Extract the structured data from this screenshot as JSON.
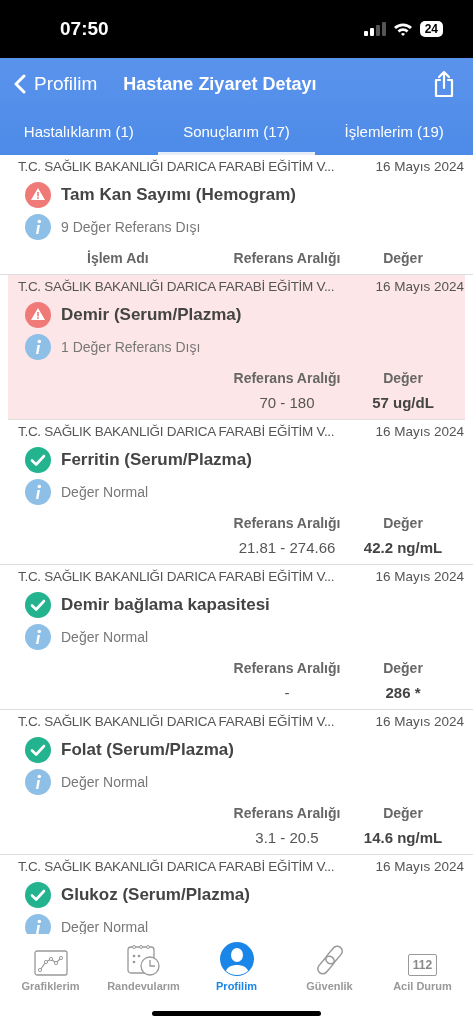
{
  "status_bar": {
    "time": "07:50",
    "battery": "24"
  },
  "header": {
    "back": "Profilim",
    "title": "Hastane Ziyaret Detayı"
  },
  "tabs": [
    {
      "label": "Hastalıklarım (1)",
      "selected": false
    },
    {
      "label": "Sonuçlarım (17)",
      "selected": true
    },
    {
      "label": "İşlemlerim (19)",
      "selected": false
    }
  ],
  "results": [
    {
      "institution": "T.C. SAĞLIK BAKANLIĞI DARICA FARABİ EĞİTİM V...",
      "date": "16 Mayıs 2024",
      "name": "Tam Kan Sayımı (Hemogram)",
      "kind": "warning",
      "summary": "9 Değer Referans Dışı",
      "highlighted": false,
      "columns": [
        "İşlem Adı",
        "Referans Aralığı",
        "Değer"
      ]
    },
    {
      "institution": "T.C. SAĞLIK BAKANLIĞI DARICA FARABİ EĞİTİM V...",
      "date": "16 Mayıs 2024",
      "name": "Demir (Serum/Plazma)",
      "kind": "warning",
      "summary": "1 Değer Referans Dışı",
      "highlighted": true,
      "columns": [
        "Referans Aralığı",
        "Değer"
      ],
      "reference": "70 - 180",
      "value": "57 ug/dL"
    },
    {
      "institution": "T.C. SAĞLIK BAKANLIĞI DARICA FARABİ EĞİTİM V...",
      "date": "16 Mayıs 2024",
      "name": "Ferritin (Serum/Plazma)",
      "kind": "ok",
      "summary": "Değer Normal",
      "highlighted": false,
      "columns": [
        "Referans Aralığı",
        "Değer"
      ],
      "reference": "21.81 - 274.66",
      "value": "42.2 ng/mL"
    },
    {
      "institution": "T.C. SAĞLIK BAKANLIĞI DARICA FARABİ EĞİTİM V...",
      "date": "16 Mayıs 2024",
      "name": "Demir bağlama kapasitesi",
      "kind": "ok",
      "summary": "Değer Normal",
      "highlighted": false,
      "columns": [
        "Referans Aralığı",
        "Değer"
      ],
      "reference": "-",
      "value": "286 *"
    },
    {
      "institution": "T.C. SAĞLIK BAKANLIĞI DARICA FARABİ EĞİTİM V...",
      "date": "16 Mayıs 2024",
      "name": "Folat (Serum/Plazma)",
      "kind": "ok",
      "summary": "Değer Normal",
      "highlighted": false,
      "columns": [
        "Referans Aralığı",
        "Değer"
      ],
      "reference": "3.1 - 20.5",
      "value": "14.6 ng/mL"
    },
    {
      "institution": "T.C. SAĞLIK BAKANLIĞI DARICA FARABİ EĞİTİM V...",
      "date": "16 Mayıs 2024",
      "name": "Glukoz (Serum/Plazma)",
      "kind": "ok",
      "summary": "Değer Normal",
      "highlighted": false
    }
  ],
  "bottom_nav": [
    {
      "label": "Grafiklerim",
      "kind": "chart",
      "selected": false
    },
    {
      "label": "Randevularım",
      "kind": "calendar",
      "selected": false
    },
    {
      "label": "Profilim",
      "kind": "profile",
      "selected": true
    },
    {
      "label": "Güvenlik",
      "kind": "link",
      "selected": false
    },
    {
      "label": "Acil Durum",
      "kind": "emergency",
      "badge": "112",
      "selected": false
    }
  ]
}
